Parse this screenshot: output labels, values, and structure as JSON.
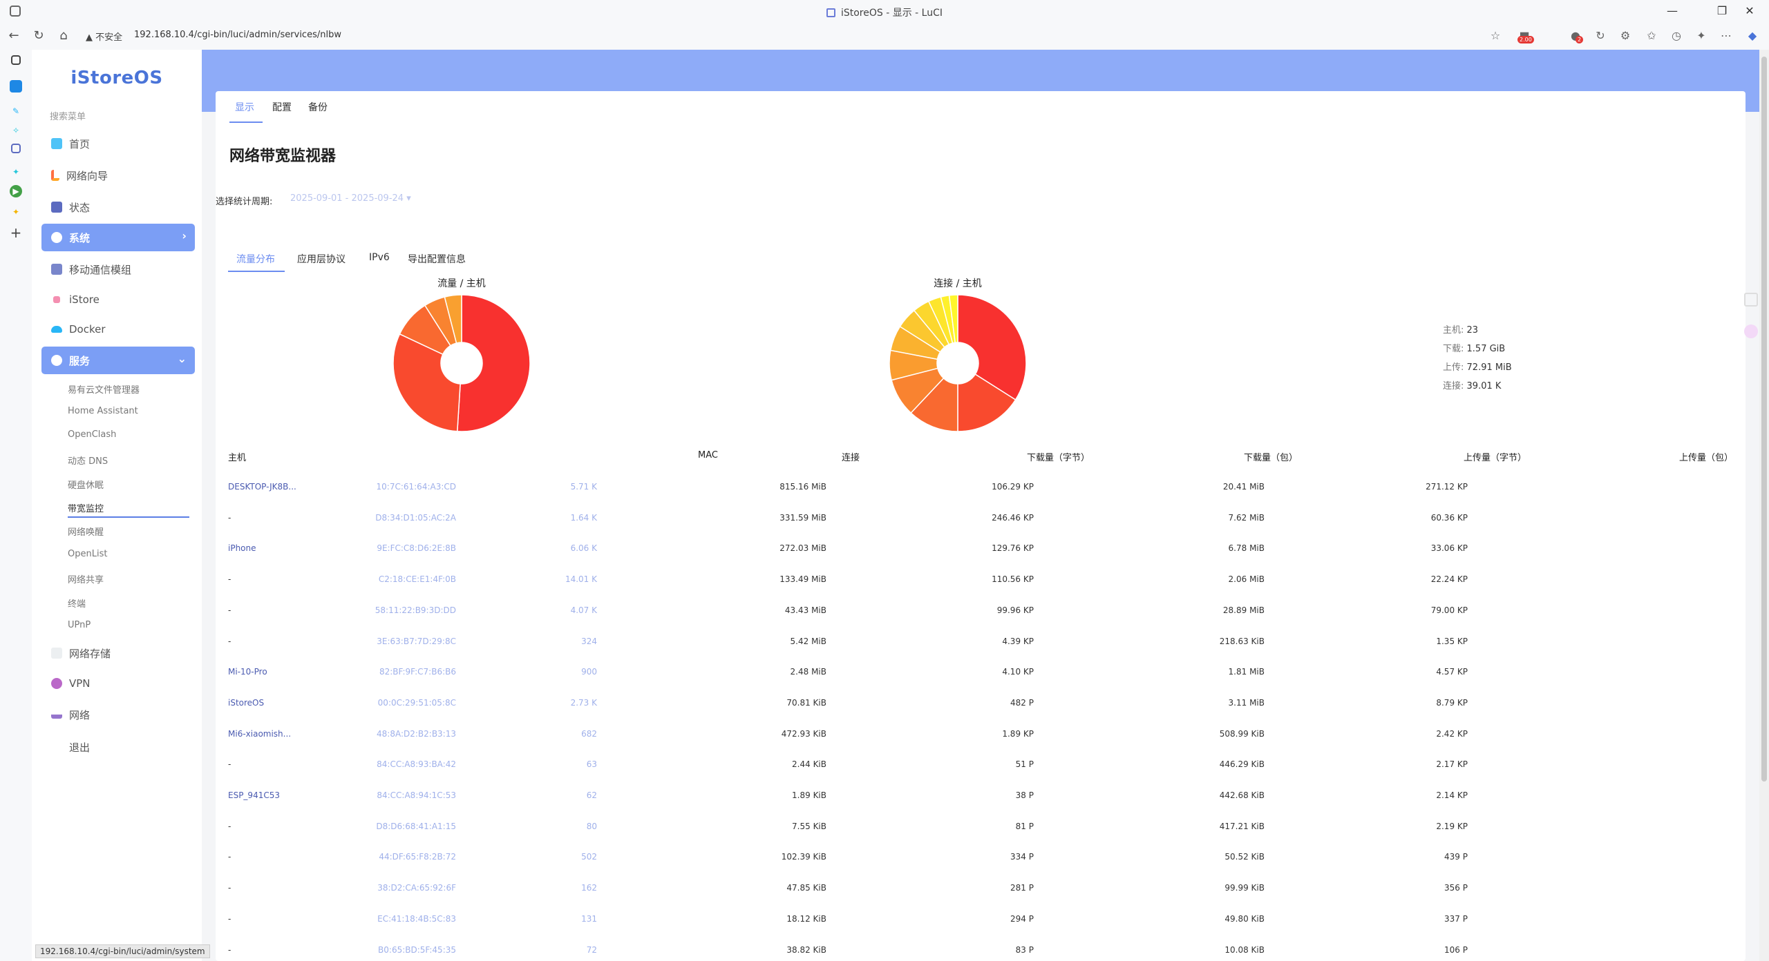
{
  "browser": {
    "window_title": "iStoreOS - 显示 - LuCI",
    "security_label": "不安全",
    "url": "192.168.10.4/cgi-bin/luci/admin/services/nlbw",
    "ext_badge": "2.00",
    "profile_badge": "2"
  },
  "sidebar": {
    "logo": "iStoreOS",
    "search_placeholder": "搜索菜单",
    "menu": [
      {
        "label": "首页",
        "icon": "home-icon"
      },
      {
        "label": "网络向导",
        "icon": "wizard-icon"
      },
      {
        "label": "状态",
        "icon": "status-icon"
      },
      {
        "label": "系统",
        "icon": "gear-icon",
        "active": true
      },
      {
        "label": "移动通信模组",
        "icon": "cube-icon"
      },
      {
        "label": "iStore",
        "icon": "store-icon"
      },
      {
        "label": "Docker",
        "icon": "docker-icon"
      },
      {
        "label": "服务",
        "icon": "services-icon",
        "active": true
      }
    ],
    "services_submenu": [
      "易有云文件管理器",
      "Home Assistant",
      "OpenClash",
      "动态 DNS",
      "硬盘休眠",
      "带宽监控",
      "网络唤醒",
      "OpenList",
      "网络共享",
      "终端",
      "UPnP"
    ],
    "bottom_menu": [
      {
        "label": "网络存储",
        "icon": "storage-icon"
      },
      {
        "label": "VPN",
        "icon": "vpn-icon"
      },
      {
        "label": "网络",
        "icon": "network-icon"
      },
      {
        "label": "退出",
        "icon": "logout-icon"
      }
    ]
  },
  "top_tabs": [
    "显示",
    "配置",
    "备份"
  ],
  "page_title": "网络带宽监视器",
  "period": {
    "label": "选择统计周期:",
    "value": "2025-09-01 - 2025-09-24"
  },
  "sub_tabs": [
    "流量分布",
    "应用层协议",
    "IPv6",
    "导出配置信息"
  ],
  "charts": {
    "traffic_title": "流量 / 主机",
    "connections_title": "连接 / 主机"
  },
  "chart_data": [
    {
      "type": "pie",
      "title": "流量 / 主机",
      "values": [
        51,
        31,
        9,
        5,
        4
      ],
      "colors": [
        "#f8312f",
        "#f94a2e",
        "#f96930",
        "#f98330",
        "#f9a030"
      ]
    },
    {
      "type": "pie",
      "title": "连接 / 主机",
      "values": [
        34,
        16,
        12,
        9,
        7,
        6,
        5,
        4,
        3,
        2,
        2
      ],
      "colors": [
        "#f8312f",
        "#f94a2e",
        "#f96930",
        "#f98330",
        "#fa9c2f",
        "#fab22f",
        "#fbc72f",
        "#fcd72d",
        "#fde52c",
        "#fef02b",
        "#fff62b"
      ]
    }
  ],
  "stats": {
    "hosts_label": "主机:",
    "hosts": "23",
    "download_label": "下载:",
    "download": "1.57 GiB",
    "upload_label": "上传:",
    "upload": "72.91 MiB",
    "conn_label": "连接:",
    "conn": "39.01 K"
  },
  "table": {
    "headers": [
      "主机",
      "MAC",
      "连接",
      "下载量（字节）",
      "下载量（包）",
      "上传量（字节）",
      "上传量（包）"
    ],
    "rows": [
      [
        "DESKTOP-JK8B...",
        "10:7C:61:64:A3:CD",
        "5.71 K",
        "815.16 MiB",
        "106.29 KP",
        "20.41 MiB",
        "271.12 KP"
      ],
      [
        "-",
        "D8:34:D1:05:AC:2A",
        "1.64 K",
        "331.59 MiB",
        "246.46 KP",
        "7.62 MiB",
        "60.36 KP"
      ],
      [
        "iPhone",
        "9E:FC:C8:D6:2E:8B",
        "6.06 K",
        "272.03 MiB",
        "129.76 KP",
        "6.78 MiB",
        "33.06 KP"
      ],
      [
        "-",
        "C2:18:CE:E1:4F:0B",
        "14.01 K",
        "133.49 MiB",
        "110.56 KP",
        "2.06 MiB",
        "22.24 KP"
      ],
      [
        "-",
        "58:11:22:B9:3D:DD",
        "4.07 K",
        "43.43 MiB",
        "99.96 KP",
        "28.89 MiB",
        "79.00 KP"
      ],
      [
        "-",
        "3E:63:B7:7D:29:8C",
        "324",
        "5.42 MiB",
        "4.39 KP",
        "218.63 KiB",
        "1.35 KP"
      ],
      [
        "Mi-10-Pro",
        "82:BF:9F:C7:B6:B6",
        "900",
        "2.48 MiB",
        "4.10 KP",
        "1.81 MiB",
        "4.57 KP"
      ],
      [
        "iStoreOS",
        "00:0C:29:51:05:8C",
        "2.73 K",
        "70.81 KiB",
        "482 P",
        "3.11 MiB",
        "8.79 KP"
      ],
      [
        "Mi6-xiaomish...",
        "48:8A:D2:B2:B3:13",
        "682",
        "472.93 KiB",
        "1.89 KP",
        "508.99 KiB",
        "2.42 KP"
      ],
      [
        "-",
        "84:CC:A8:93:BA:42",
        "63",
        "2.44 KiB",
        "51 P",
        "446.29 KiB",
        "2.17 KP"
      ],
      [
        "ESP_941C53",
        "84:CC:A8:94:1C:53",
        "62",
        "1.89 KiB",
        "38 P",
        "442.68 KiB",
        "2.14 KP"
      ],
      [
        "-",
        "D8:D6:68:41:A1:15",
        "80",
        "7.55 KiB",
        "81 P",
        "417.21 KiB",
        "2.19 KP"
      ],
      [
        "-",
        "44:DF:65:F8:2B:72",
        "502",
        "102.39 KiB",
        "334 P",
        "50.52 KiB",
        "439 P"
      ],
      [
        "-",
        "38:D2:CA:65:92:6F",
        "162",
        "47.85 KiB",
        "281 P",
        "99.99 KiB",
        "356 P"
      ],
      [
        "-",
        "EC:41:18:4B:5C:83",
        "131",
        "18.12 KiB",
        "294 P",
        "49.80 KiB",
        "337 P"
      ],
      [
        "-",
        "B0:65:BD:5F:45:35",
        "72",
        "38.82 KiB",
        "83 P",
        "10.08 KiB",
        "106 P"
      ]
    ]
  },
  "status_bar_url": "192.168.10.4/cgi-bin/luci/admin/system"
}
